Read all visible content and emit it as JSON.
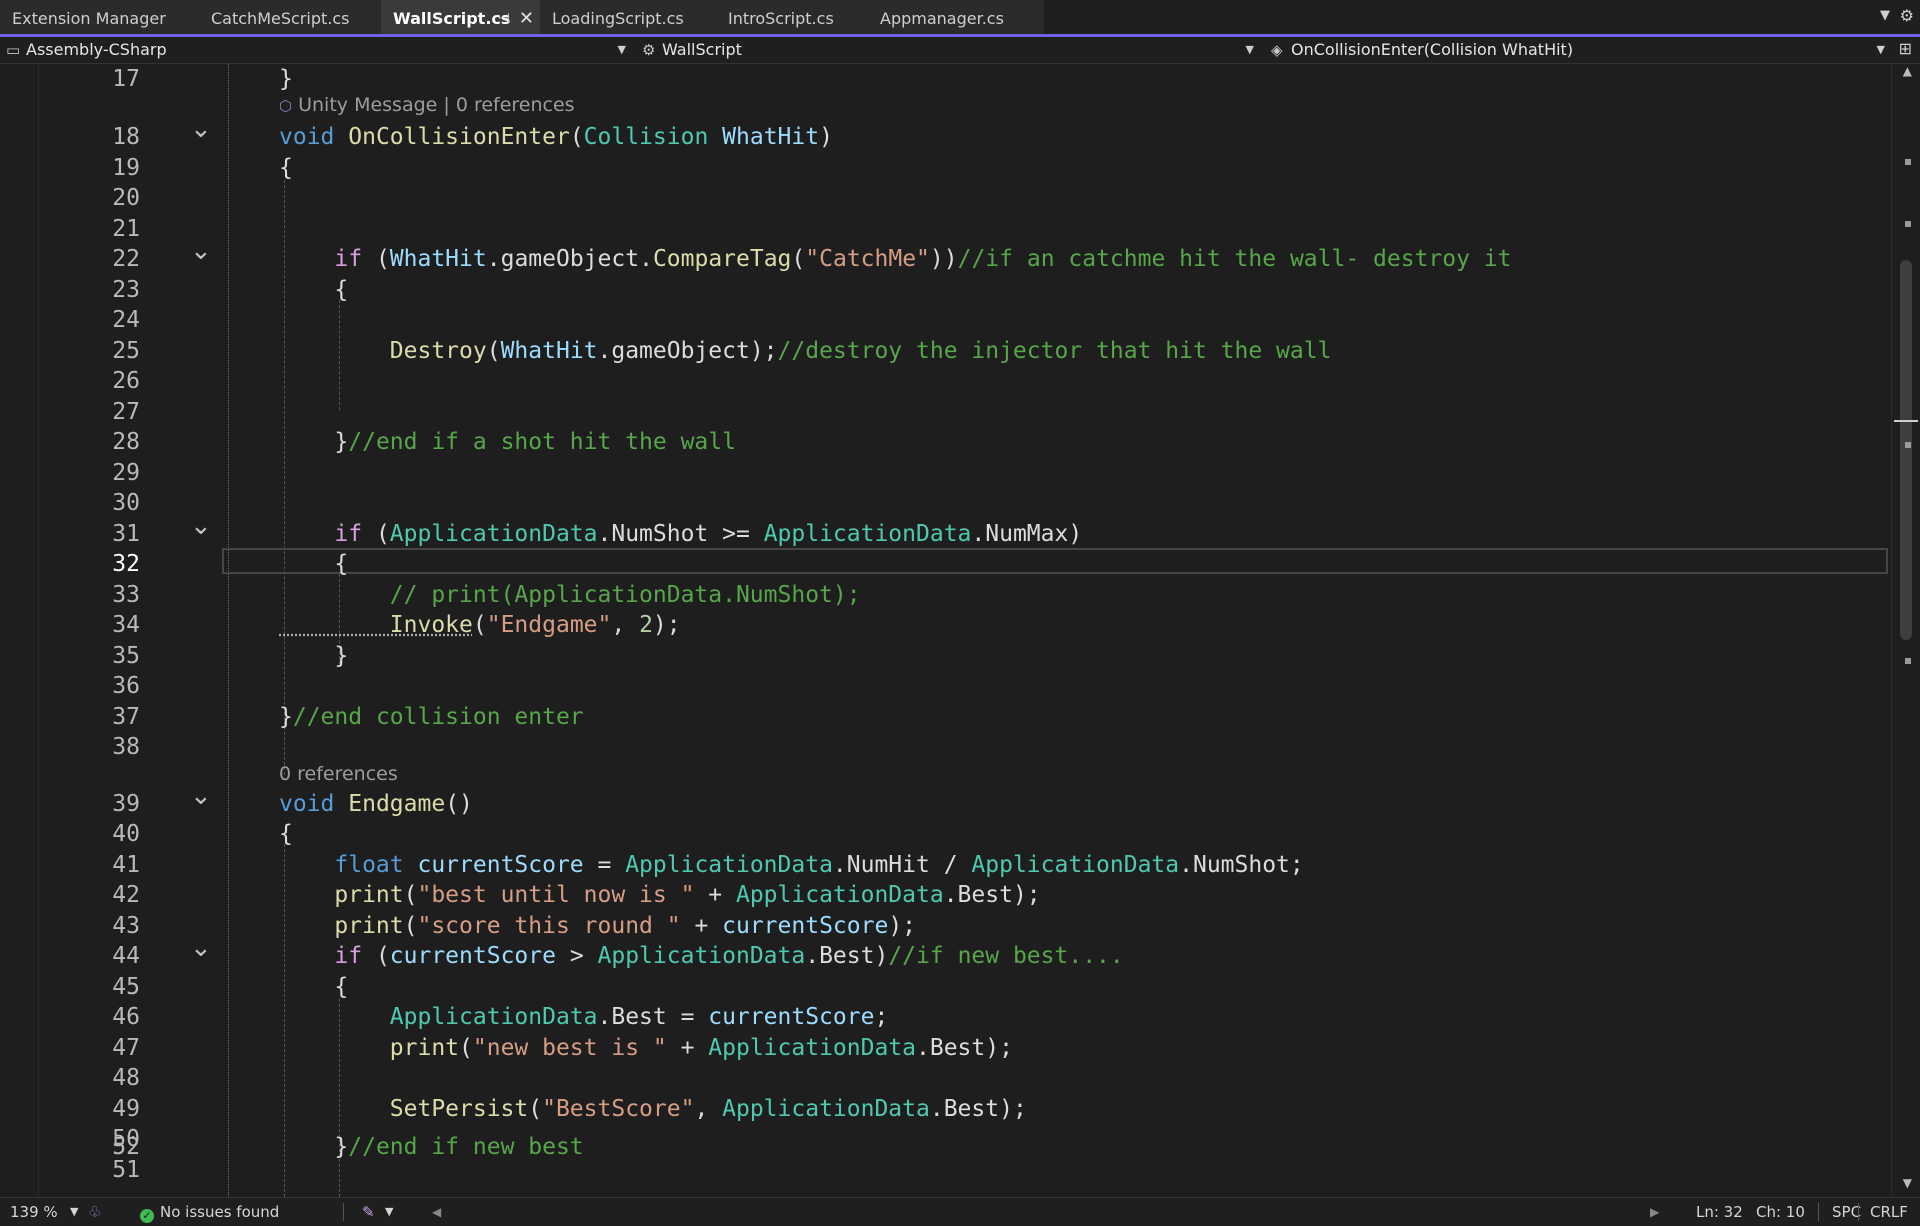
{
  "tabs": [
    {
      "label": "Extension Manager",
      "active": false
    },
    {
      "label": "CatchMeScript.cs",
      "active": false
    },
    {
      "label": "WallScript.cs",
      "active": true
    },
    {
      "label": "LoadingScript.cs",
      "active": false
    },
    {
      "label": "IntroScript.cs",
      "active": false
    },
    {
      "label": "Appmanager.cs",
      "active": false
    }
  ],
  "tab_icons": {
    "pin": "pin-icon",
    "close": "close-icon",
    "overflow": "chevron-down-icon",
    "settings": "gear-icon"
  },
  "navbar": {
    "project": "Assembly-CSharp",
    "type": "WallScript",
    "member": "OnCollisionEnter(Collision WhatHit)"
  },
  "codelens": {
    "unity_message": "Unity Message | 0 references",
    "endgame_refs": "0 references"
  },
  "lines": [
    {
      "n": "17",
      "code": [
        [
          "pl",
          "}"
        ]
      ]
    },
    {
      "n": "18",
      "fold": true,
      "code": [
        [
          "kw",
          "void "
        ],
        [
          "fn",
          "OnCollisionEnter"
        ],
        [
          "pl",
          "("
        ],
        [
          "ty",
          "Collision "
        ],
        [
          "id",
          "WhatHit"
        ],
        [
          "pl",
          ")"
        ]
      ]
    },
    {
      "n": "19",
      "code": [
        [
          "pl",
          "{"
        ]
      ]
    },
    {
      "n": "20",
      "code": []
    },
    {
      "n": "21",
      "code": []
    },
    {
      "n": "22",
      "fold": true,
      "code": [
        [
          "ctl",
          "    if "
        ],
        [
          "pl",
          "("
        ],
        [
          "id",
          "WhatHit"
        ],
        [
          "pl",
          "."
        ],
        [
          "pl",
          "gameObject"
        ],
        [
          "pl",
          "."
        ],
        [
          "fn",
          "CompareTag"
        ],
        [
          "pl",
          "("
        ],
        [
          "str",
          "\"CatchMe\""
        ],
        [
          "pl",
          "))"
        ],
        [
          "cm",
          "//if an catchme hit the wall- destroy it"
        ]
      ]
    },
    {
      "n": "23",
      "code": [
        [
          "pl",
          "    {"
        ]
      ]
    },
    {
      "n": "24",
      "code": []
    },
    {
      "n": "25",
      "code": [
        [
          "fn",
          "        Destroy"
        ],
        [
          "pl",
          "("
        ],
        [
          "id",
          "WhatHit"
        ],
        [
          "pl",
          ".gameObject);"
        ],
        [
          "cm",
          "//destroy the injector that hit the wall"
        ]
      ]
    },
    {
      "n": "26",
      "code": []
    },
    {
      "n": "27",
      "code": []
    },
    {
      "n": "28",
      "code": [
        [
          "pl",
          "    }"
        ],
        [
          "cm",
          "//end if a shot hit the wall"
        ]
      ]
    },
    {
      "n": "29",
      "code": []
    },
    {
      "n": "30",
      "code": []
    },
    {
      "n": "31",
      "fold": true,
      "code": [
        [
          "ctl",
          "    if "
        ],
        [
          "pl",
          "("
        ],
        [
          "ty",
          "ApplicationData"
        ],
        [
          "pl",
          ".NumShot >= "
        ],
        [
          "ty",
          "ApplicationData"
        ],
        [
          "pl",
          ".NumMax)"
        ]
      ]
    },
    {
      "n": "32",
      "current": true,
      "code": [
        [
          "pl",
          "    {"
        ]
      ]
    },
    {
      "n": "33",
      "code": [
        [
          "cm",
          "        // print(ApplicationData.NumShot);"
        ]
      ]
    },
    {
      "n": "34",
      "code": [
        [
          "fn",
          "        Invoke"
        ],
        [
          "pl",
          "("
        ],
        [
          "str",
          "\"Endgame\""
        ],
        [
          "pl",
          ", "
        ],
        [
          "num",
          "2"
        ],
        [
          "pl",
          ");"
        ]
      ]
    },
    {
      "n": "35",
      "code": [
        [
          "pl",
          "    }"
        ]
      ]
    },
    {
      "n": "36",
      "code": []
    },
    {
      "n": "37",
      "code": [
        [
          "pl",
          "}"
        ],
        [
          "cm",
          "//end collision enter"
        ]
      ]
    },
    {
      "n": "38",
      "code": []
    },
    {
      "n": "39",
      "fold": true,
      "code": [
        [
          "kw",
          "void "
        ],
        [
          "fn",
          "Endgame"
        ],
        [
          "pl",
          "()"
        ]
      ]
    },
    {
      "n": "40",
      "code": [
        [
          "pl",
          "{"
        ]
      ]
    },
    {
      "n": "41",
      "code": [
        [
          "kw",
          "    float "
        ],
        [
          "id",
          "currentScore"
        ],
        [
          "pl",
          " = "
        ],
        [
          "ty",
          "ApplicationData"
        ],
        [
          "pl",
          ".NumHit / "
        ],
        [
          "ty",
          "ApplicationData"
        ],
        [
          "pl",
          ".NumShot;"
        ]
      ]
    },
    {
      "n": "42",
      "code": [
        [
          "fn",
          "    print"
        ],
        [
          "pl",
          "("
        ],
        [
          "str",
          "\"best until now is \""
        ],
        [
          "pl",
          " + "
        ],
        [
          "ty",
          "ApplicationData"
        ],
        [
          "pl",
          ".Best);"
        ]
      ]
    },
    {
      "n": "43",
      "code": [
        [
          "fn",
          "    print"
        ],
        [
          "pl",
          "("
        ],
        [
          "str",
          "\"score this round \""
        ],
        [
          "pl",
          " + "
        ],
        [
          "id",
          "currentScore"
        ],
        [
          "pl",
          ");"
        ]
      ]
    },
    {
      "n": "44",
      "fold": true,
      "code": [
        [
          "ctl",
          "    if "
        ],
        [
          "pl",
          "("
        ],
        [
          "id",
          "currentScore"
        ],
        [
          "pl",
          " > "
        ],
        [
          "ty",
          "ApplicationData"
        ],
        [
          "pl",
          ".Best)"
        ],
        [
          "cm",
          "//if new best...."
        ]
      ]
    },
    {
      "n": "45",
      "code": [
        [
          "pl",
          "    {"
        ]
      ]
    },
    {
      "n": "46",
      "code": [
        [
          "ty",
          "        ApplicationData"
        ],
        [
          "pl",
          ".Best = "
        ],
        [
          "id",
          "currentScore"
        ],
        [
          "pl",
          ";"
        ]
      ]
    },
    {
      "n": "47",
      "code": [
        [
          "fn",
          "        print"
        ],
        [
          "pl",
          "("
        ],
        [
          "str",
          "\"new best is \""
        ],
        [
          "pl",
          " + "
        ],
        [
          "ty",
          "ApplicationData"
        ],
        [
          "pl",
          ".Best);"
        ]
      ]
    },
    {
      "n": "48",
      "code": []
    },
    {
      "n": "49",
      "code": [
        [
          "fn",
          "        SetPersist"
        ],
        [
          "pl",
          "("
        ],
        [
          "str",
          "\"BestScore\""
        ],
        [
          "pl",
          ", "
        ],
        [
          "ty",
          "ApplicationData"
        ],
        [
          "pl",
          ".Best);"
        ]
      ]
    },
    {
      "n": "50",
      "code": []
    },
    {
      "n": "51",
      "code": []
    },
    {
      "n": "52",
      "code": [
        [
          "pl",
          "    }"
        ],
        [
          "cm",
          "//end if new best"
        ]
      ]
    }
  ],
  "status": {
    "zoom": "139 %",
    "issues": "No issues found",
    "line": "Ln: 32",
    "col": "Ch: 10",
    "spacing": "SPC",
    "eol": "CRLF"
  }
}
